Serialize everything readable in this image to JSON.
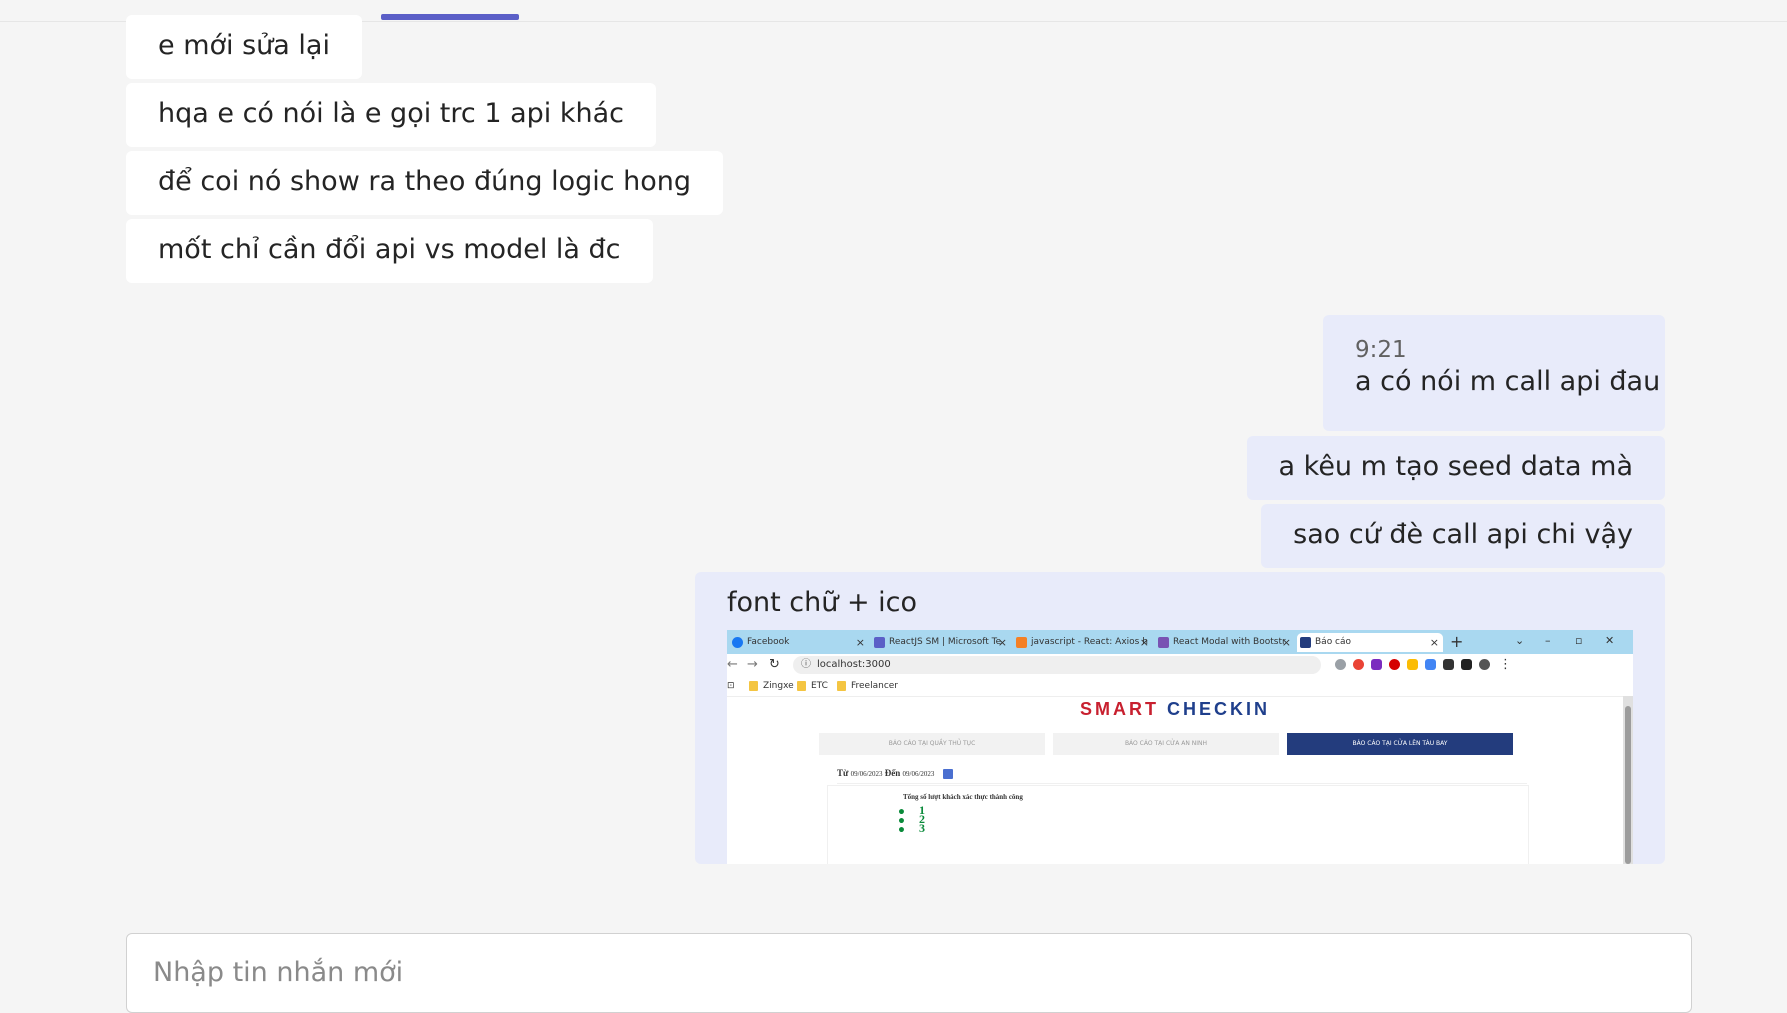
{
  "incoming_messages": [
    {
      "text": "e mới sửa lại"
    },
    {
      "text": "hqa e có nói là e gọi trc 1 api khác"
    },
    {
      "text": "để coi nó show ra theo đúng logic hong"
    },
    {
      "text": "mốt chỉ cần đổi api vs model là đc"
    }
  ],
  "outgoing_group": {
    "time": "9:21",
    "messages": [
      {
        "text": "a có nói m call api đau"
      },
      {
        "text": "a kêu m tạo seed data mà"
      },
      {
        "text": "sao cứ đè call api chi vậy"
      },
      {
        "text": "font chữ + ico"
      }
    ]
  },
  "attachment": {
    "browser": {
      "tabs": [
        {
          "label": "Facebook",
          "icon_color": "#1877f2"
        },
        {
          "label": "ReactJS SM | Microsoft Te",
          "icon_color": "#5b5fc7"
        },
        {
          "label": "javascript - React: Axios h",
          "icon_color": "#f48024"
        },
        {
          "label": "React Modal with Bootstr",
          "icon_color": "#7952b3"
        },
        {
          "label": "Báo cáo",
          "icon_color": "#233c7d",
          "active": true
        }
      ],
      "url": "localhost:3000",
      "bookmarks": [
        "Zingxe",
        "ETC",
        "Freelancer"
      ]
    },
    "app": {
      "brand_part1": "SMART",
      "brand_part2": "CHECKIN",
      "report_tabs": [
        {
          "label": "BÁO CÁO TẠI QUẦY THỦ TỤC",
          "active": false
        },
        {
          "label": "BÁO CÁO TẠI CỬA AN NINH",
          "active": false
        },
        {
          "label": "BÁO CÁO TẠI CỬA LÊN TÀU BAY",
          "active": true
        }
      ],
      "from_label": "Từ",
      "from_date": "09/06/2023",
      "to_label": "Đến",
      "to_date": "09/06/2023",
      "stat_title": "Tổng số lượt khách xác thực thành công",
      "stat_values": [
        "1",
        "2",
        "3"
      ]
    }
  },
  "composer": {
    "placeholder": "Nhập tin nhắn mới"
  },
  "colors": {
    "accent": "#5b5fc7",
    "outgoing_bubble": "#e8ebfa",
    "incoming_bubble": "#ffffff",
    "background": "#f5f5f5"
  }
}
